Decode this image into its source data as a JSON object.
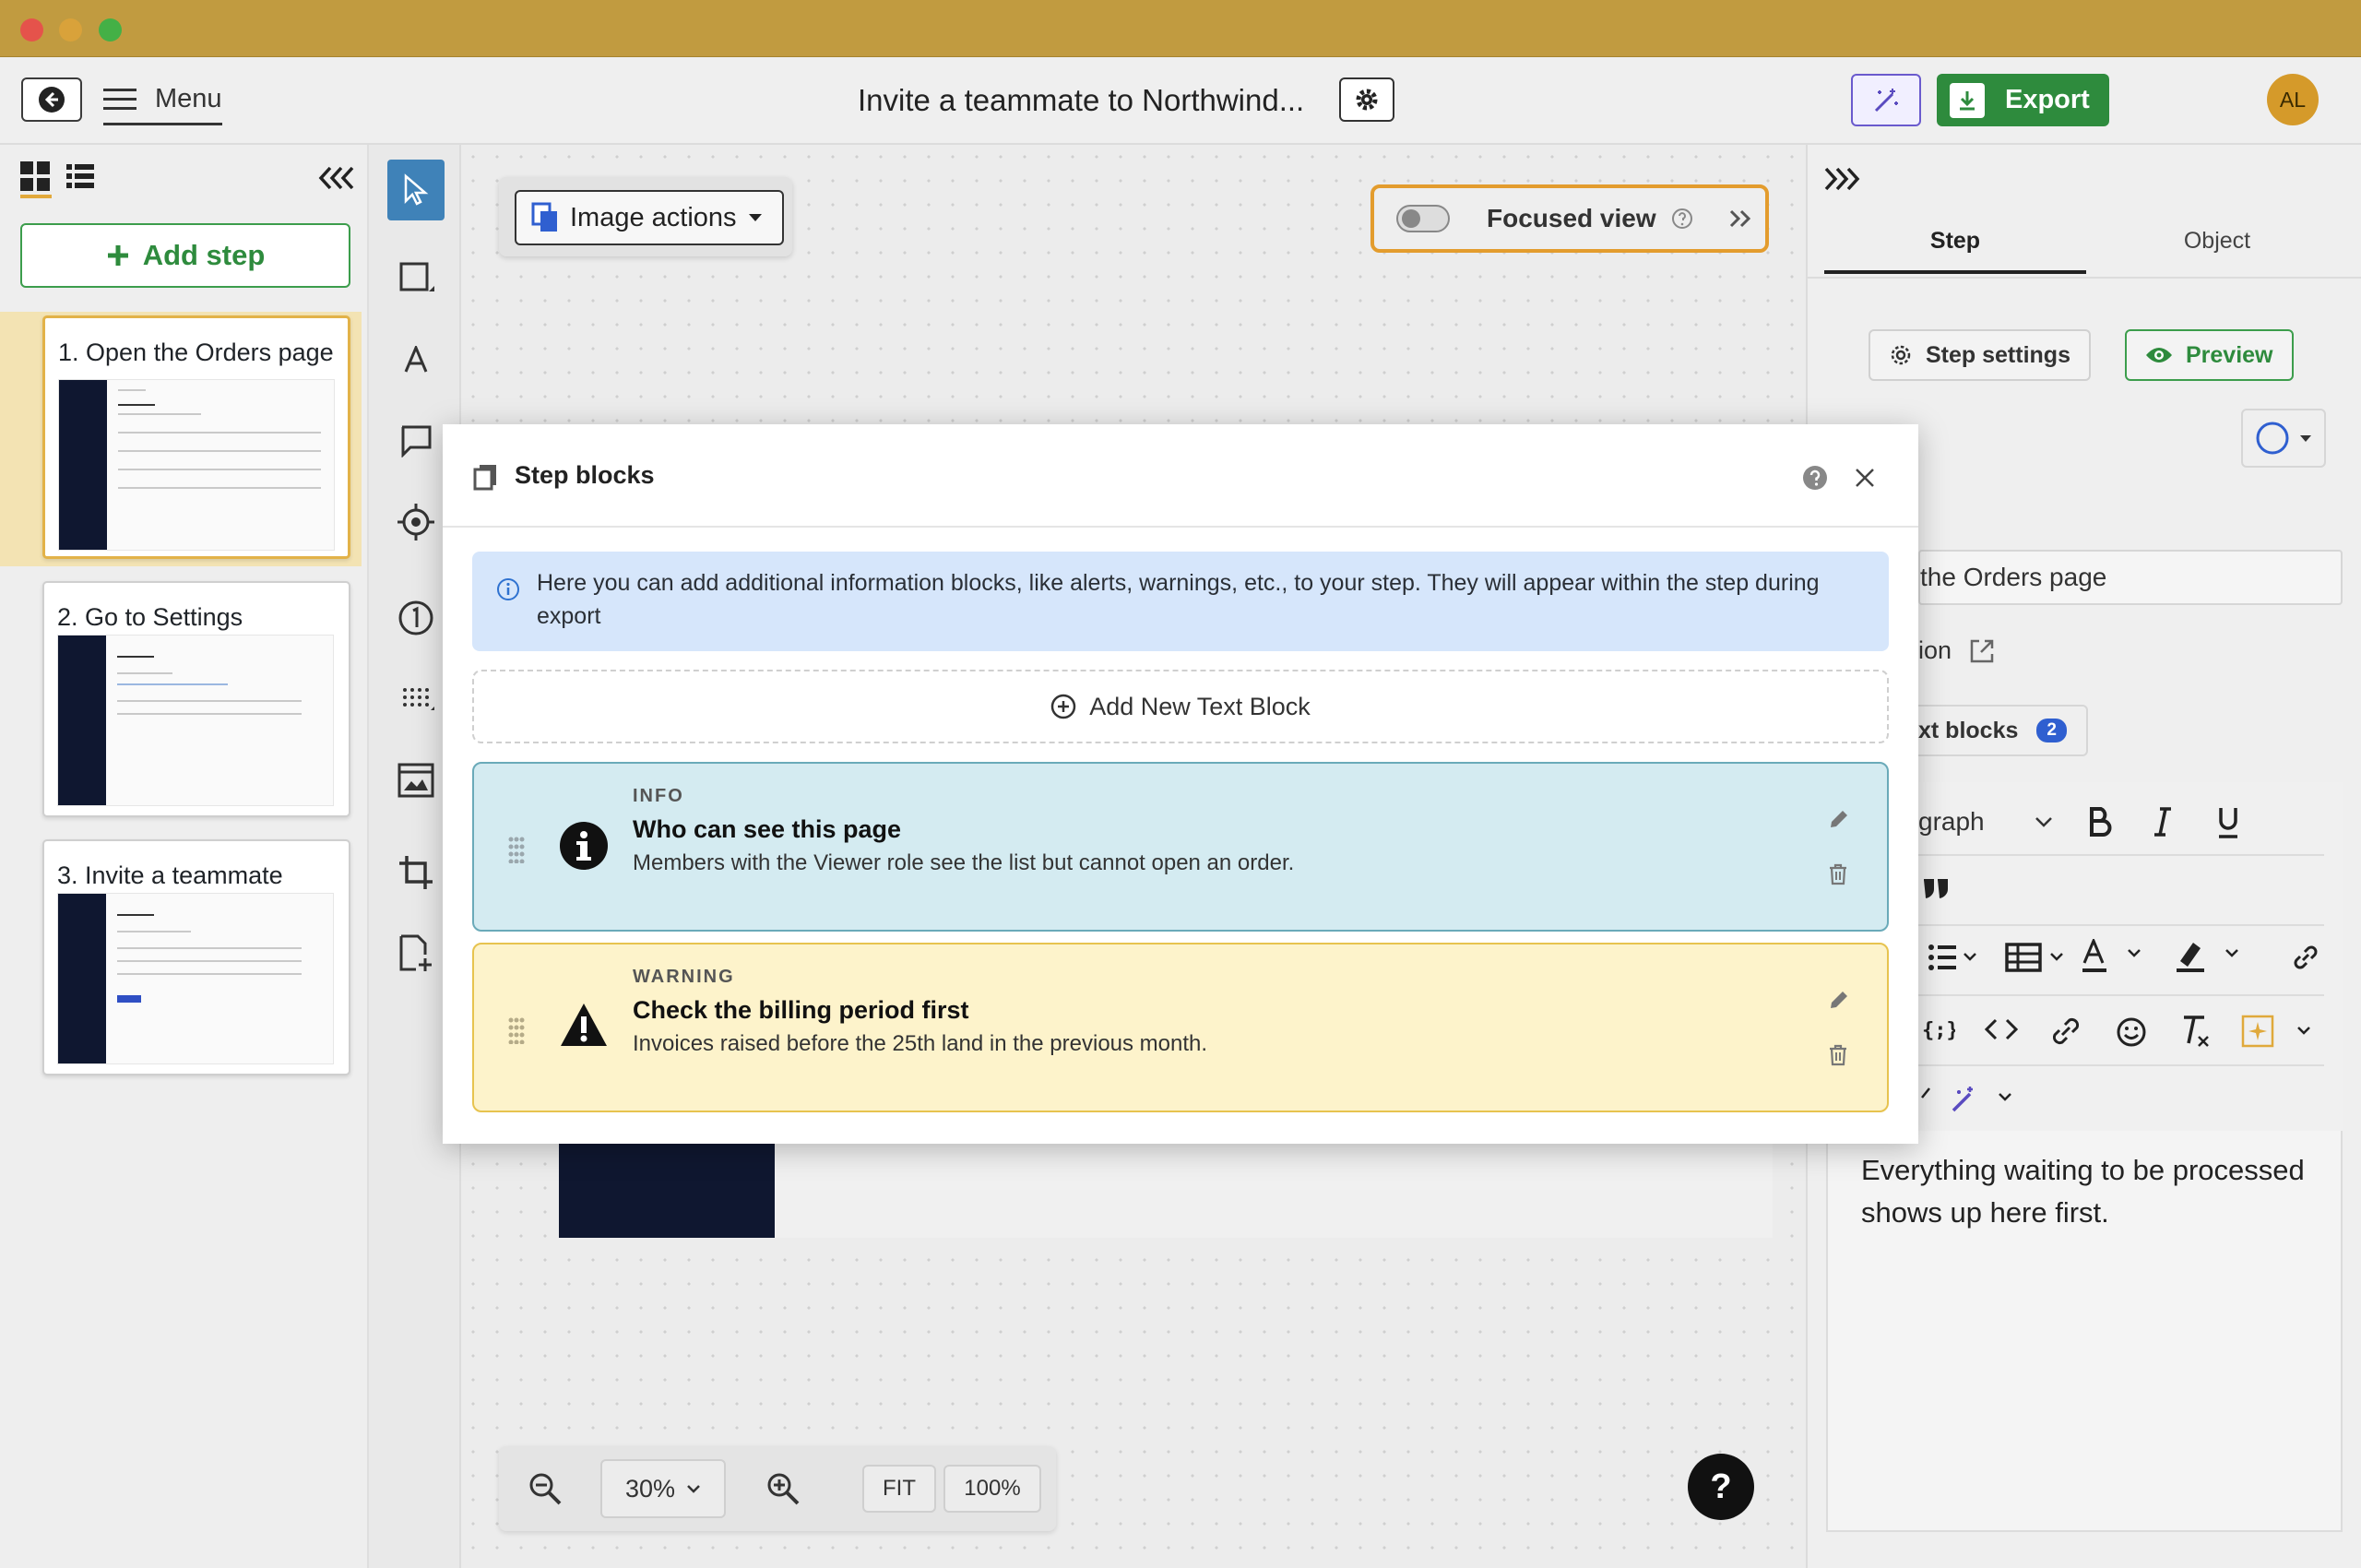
{
  "window": {
    "traffic_lights": [
      "#e5534b",
      "#d9a23a",
      "#44b046"
    ]
  },
  "header": {
    "menu_label": "Menu",
    "doc_title": "Invite a teammate to Northwind...",
    "export_label": "Export",
    "avatar_initials": "AL"
  },
  "left_panel": {
    "add_step_label": "Add step",
    "steps": [
      {
        "label": "1. Open the Orders page"
      },
      {
        "label": "2. Go to Settings"
      },
      {
        "label": "3. Invite a teammate"
      }
    ]
  },
  "canvas": {
    "image_actions_label": "Image actions",
    "focused_view_label": "Focused view",
    "zoom": {
      "level": "30%",
      "fit_label": "FIT",
      "full_label": "100%"
    },
    "help_label": "?"
  },
  "right_panel": {
    "tabs": [
      {
        "label": "Step"
      },
      {
        "label": "Object"
      }
    ],
    "step_settings_label": "Step settings",
    "preview_label": "Preview",
    "title_field_partial": "the Orders page",
    "description_partial": "ion",
    "text_blocks_partial": "xt blocks",
    "text_blocks_count": "2",
    "paragraph_partial": "graph",
    "editor_text": "Everything waiting to be processed shows up here first."
  },
  "modal": {
    "title": "Step blocks",
    "info_text": "Here you can add additional information blocks, like alerts, warnings, etc., to your step. They will appear within the step during export",
    "add_label": "Add New Text Block",
    "blocks": [
      {
        "kind": "INFO",
        "title": "Who can see this page",
        "text": "Members with the Viewer role see the list but cannot open an order."
      },
      {
        "kind": "WARNING",
        "title": "Check the billing period first",
        "text": "Invoices raised before the 25th land in the previous month."
      }
    ]
  },
  "colors": {
    "accent_green": "#2e8b3d",
    "focus_orange": "#e39c2d",
    "info_bg": "#d4ebf1",
    "warn_bg": "#fdf3cb"
  }
}
